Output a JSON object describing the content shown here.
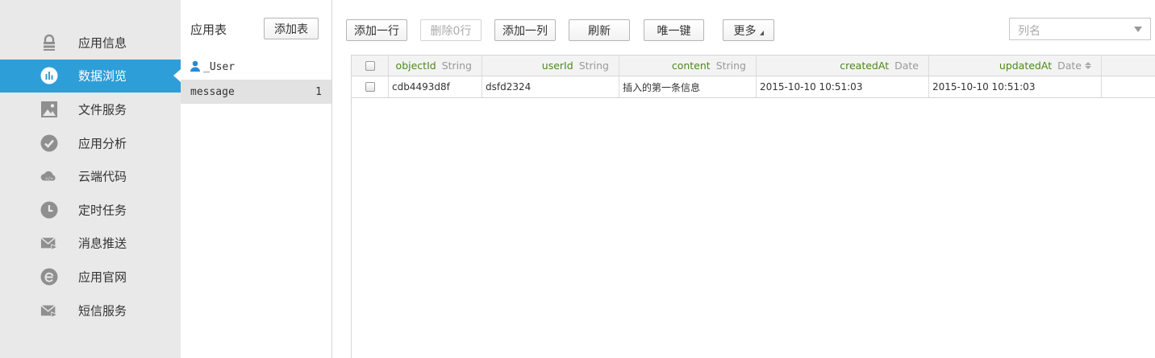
{
  "sidebar": {
    "items": [
      {
        "label": "应用信息",
        "icon": "lock-icon",
        "active": false
      },
      {
        "label": "数据浏览",
        "icon": "bar-chart-icon",
        "active": true
      },
      {
        "label": "文件服务",
        "icon": "image-icon",
        "active": false
      },
      {
        "label": "应用分析",
        "icon": "checkmark-icon",
        "active": false
      },
      {
        "label": "云端代码",
        "icon": "cloud-icon",
        "active": false
      },
      {
        "label": "定时任务",
        "icon": "clock-icon",
        "active": false
      },
      {
        "label": "消息推送",
        "icon": "mail-send-icon",
        "active": false
      },
      {
        "label": "应用官网",
        "icon": "ie-browser-icon",
        "active": false
      },
      {
        "label": "短信服务",
        "icon": "sms-icon",
        "active": false
      }
    ]
  },
  "tables_panel": {
    "title": "应用表",
    "add_label": "添加表",
    "items": [
      {
        "name": "_User",
        "count": "",
        "icon": "user-icon"
      },
      {
        "name": "message",
        "count": "1"
      }
    ]
  },
  "toolbar": {
    "add_row": "添加一行",
    "delete_row": "删除0行",
    "add_column": "添加一列",
    "refresh": "刷新",
    "unique_key": "唯一键",
    "more": "更多",
    "column_select_placeholder": "列名"
  },
  "grid": {
    "columns": [
      {
        "name": "objectId",
        "type": "String"
      },
      {
        "name": "userId",
        "type": "String"
      },
      {
        "name": "content",
        "type": "String"
      },
      {
        "name": "createdAt",
        "type": "Date"
      },
      {
        "name": "updatedAt",
        "type": "Date"
      }
    ],
    "rows": [
      [
        "cdb4493d8f",
        "dsfd2324",
        "插入的第一条信息",
        "2015-10-10 10:51:03",
        "2015-10-10 10:51:03"
      ]
    ]
  },
  "colors": {
    "sidebar_bg": "#e9e9e9",
    "active_bg": "#2e9ed8",
    "column_name": "#4a8a1c",
    "icon_gray": "#8f8f8f"
  }
}
